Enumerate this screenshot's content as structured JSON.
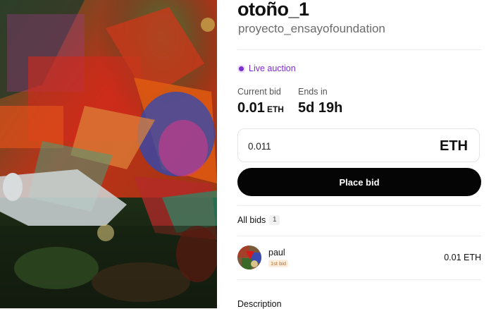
{
  "artwork": {
    "alt": "otoño_1 artwork"
  },
  "item": {
    "title": "otoño_1",
    "collection": "proyecto_ensayofoundation"
  },
  "auction": {
    "status": "Live auction",
    "current_bid_label": "Current bid",
    "current_bid_value": "0.01",
    "current_bid_currency": "ETH",
    "ends_in_label": "Ends in",
    "ends_in_value": "5d 19h"
  },
  "bid_form": {
    "amount": "0.011",
    "currency": "ETH",
    "submit_label": "Place bid"
  },
  "bids": {
    "header": "All bids",
    "count": "1",
    "items": [
      {
        "bidder": "paul",
        "badge": "1st bid",
        "amount": "0.01 ETH"
      }
    ]
  },
  "description": {
    "header": "Description"
  },
  "colors": {
    "accent": "#7b2fd0",
    "button": "#050505"
  }
}
